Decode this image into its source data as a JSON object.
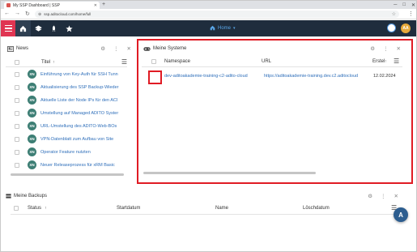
{
  "browser": {
    "tab_title": "My SSP Dashboard | SSP",
    "new_tab": "+",
    "url": "ssp.aditocloud.com/home/full",
    "window_controls": [
      "─",
      "□",
      "✕"
    ]
  },
  "appbar": {
    "home_label": "Home",
    "home_chevron": "▾",
    "avatar_initials": "AA",
    "colors": {
      "bar": "#1f2d3d",
      "menu": "#e03552",
      "accent": "#5aa7e8",
      "avatar": "#e6a93a"
    }
  },
  "news": {
    "title": "News",
    "column_title": "Titel",
    "sort_arrow": "↑",
    "badge": "XN",
    "items": [
      "Einführung von Key-Auth für SSH Tunn",
      "Aktualisierung des SSP Backup-Wieder",
      "Aktuelle Liste der Node IPs für den ACI",
      "Umstellung auf Managed ADITO Syster",
      "URL-Umstellung des ADITO-Web-BOs",
      "VPN-Datenblatt zum Aufbau von Site",
      "Operator Feature nutzten",
      "Neuer Releaseprozess für xRM Basic"
    ]
  },
  "systems": {
    "title": "Meine Systeme",
    "columns": [
      "Namespace",
      "URL",
      "Erstel"
    ],
    "sort_arrow": "↑",
    "rows": [
      {
        "namespace": "dev-aditoakademie-training-c2-adito-cloud",
        "url": "https://aditoakademie-training.dev.c2.aditocloud",
        "created": "12.02.2024"
      }
    ]
  },
  "backups": {
    "title": "Meine Backups",
    "columns": [
      "Status",
      "Startdatum",
      "Name",
      "Löschdatum"
    ],
    "sort_arrow": "↑"
  },
  "fab_label": "A"
}
